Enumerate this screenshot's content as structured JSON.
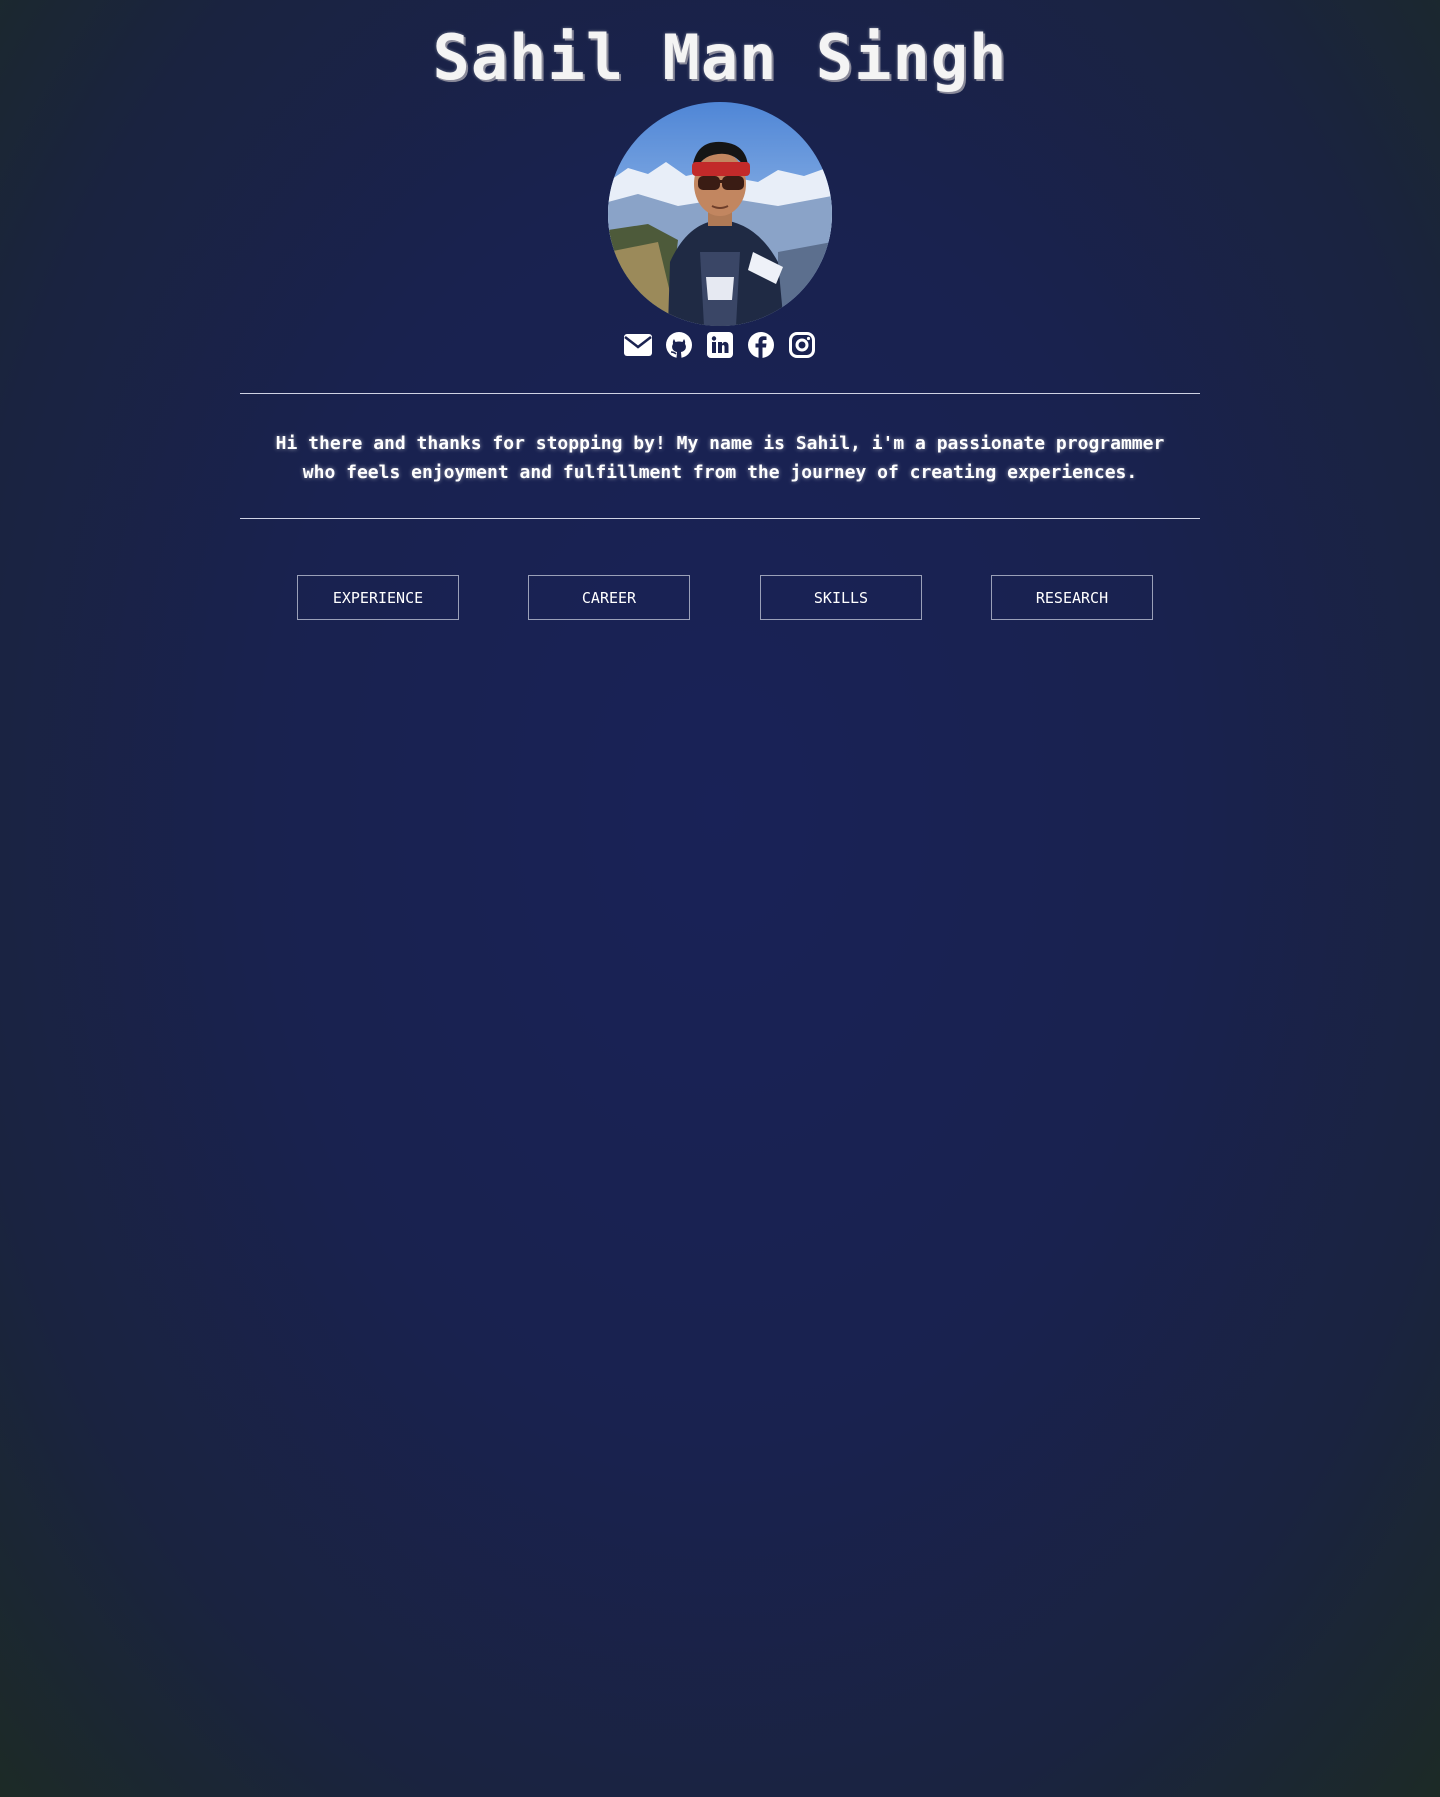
{
  "header": {
    "name": "Sahil Man Singh"
  },
  "profile": {
    "avatar_alt": "profile-photo"
  },
  "socials": [
    {
      "icon": "envelope-icon"
    },
    {
      "icon": "github-icon"
    },
    {
      "icon": "linkedin-icon"
    },
    {
      "icon": "facebook-icon"
    },
    {
      "icon": "instagram-icon"
    }
  ],
  "bio": {
    "text": "Hi there and thanks for stopping by! My name is Sahil, i'm a passionate programmer who feels enjoyment and fulfillment from the journey of creating experiences."
  },
  "nav": {
    "experience": "EXPERIENCE",
    "career": "CAREER",
    "skills": "SKILLS",
    "research": "RESEARCH"
  },
  "colors": {
    "background": "#19224f",
    "text": "#ffffff",
    "divider": "#cfd3e4",
    "button_border": "#9aa0b8"
  }
}
